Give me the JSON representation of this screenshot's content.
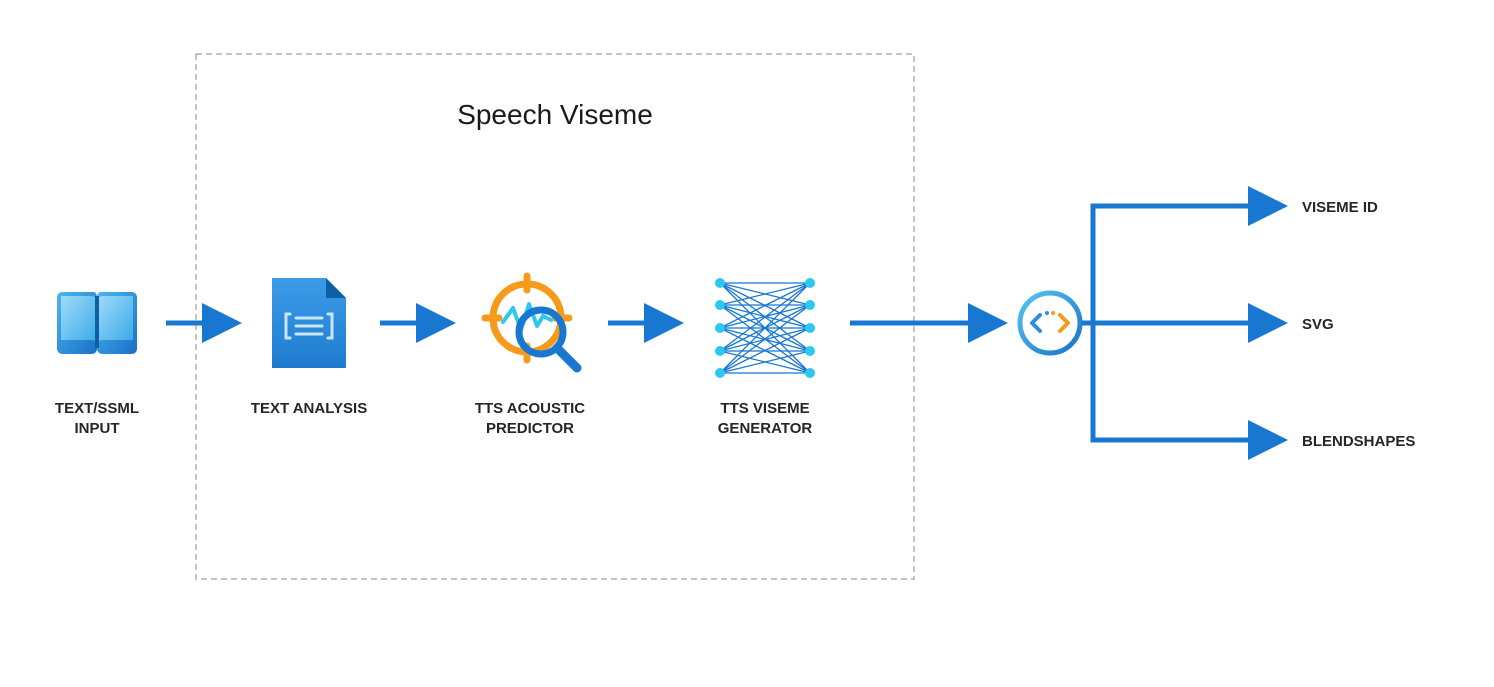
{
  "title": "Speech  Viseme",
  "nodes": {
    "input": {
      "label_line1": "TEXT/SSML",
      "label_line2": "INPUT"
    },
    "analysis": {
      "label": "TEXT ANALYSIS"
    },
    "acoustic": {
      "label_line1": "TTS ACOUSTIC",
      "label_line2": "PREDICTOR"
    },
    "viseme": {
      "label_line1": "TTS VISEME",
      "label_line2": "GENERATOR"
    }
  },
  "outputs": {
    "top": "VISEME ID",
    "middle": "SVG",
    "bottom": "BLENDSHAPES"
  },
  "icons": {
    "input": "book-icon",
    "analysis": "document-icon",
    "acoustic": "target-search-icon",
    "viseme": "neural-net-icon",
    "code": "code-circle-icon"
  },
  "colors": {
    "primary": "#1878D1",
    "primary2": "#2E8DE1",
    "accent": "#F79A1B",
    "light": "#4ECFF7",
    "cyan": "#2AC8F2"
  }
}
